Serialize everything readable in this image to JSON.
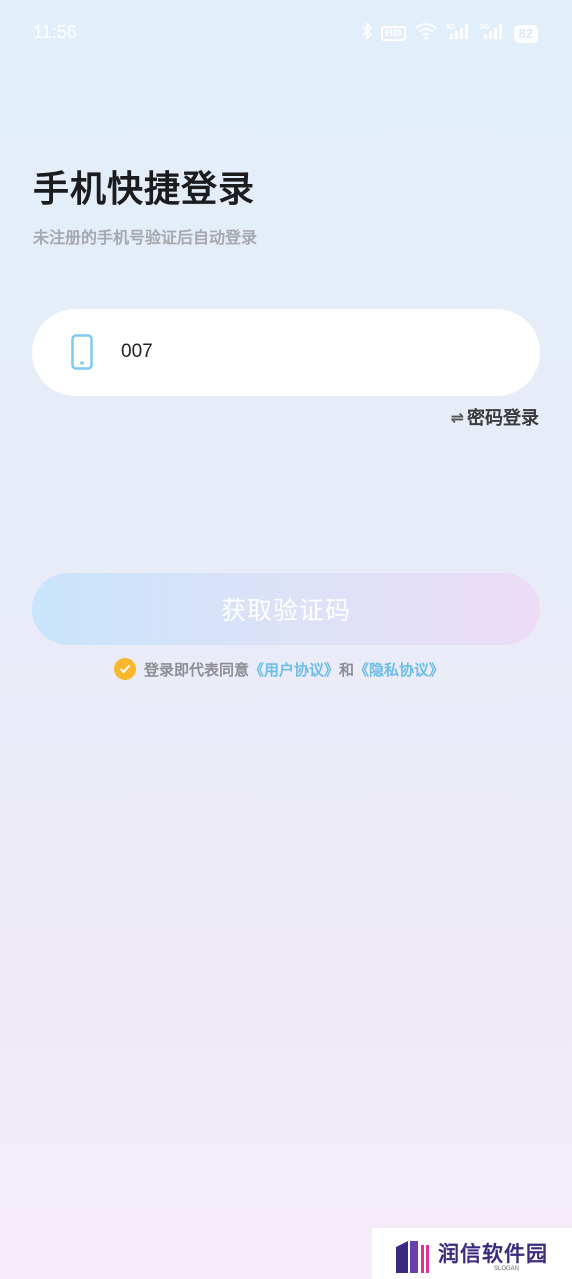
{
  "status_bar": {
    "time": "11:56",
    "hd_label": "HD",
    "battery": "82",
    "icons": [
      "bluetooth-icon",
      "hd-icon",
      "wifi-icon",
      "signal-5g-icon",
      "signal-5g-icon",
      "battery-icon"
    ]
  },
  "header": {
    "title": "手机快捷登录",
    "subtitle": "未注册的手机号验证后自动登录"
  },
  "phone_field": {
    "value": "007",
    "icon": "phone-icon"
  },
  "switch_login": {
    "icon": "⇌",
    "label": "密码登录"
  },
  "get_code_button": {
    "label": "获取验证码"
  },
  "agreement": {
    "prefix": "登录即代表同意",
    "user_agreement": "《用户协议》",
    "conjunction": "和",
    "privacy_agreement": "《隐私协议》"
  },
  "watermark": {
    "name": "润信软件园",
    "slogan": "SLOGAN"
  },
  "colors": {
    "accent_link": "#6dbde9",
    "check": "#f9b82c",
    "brand_purple": "#3b2a7f"
  }
}
